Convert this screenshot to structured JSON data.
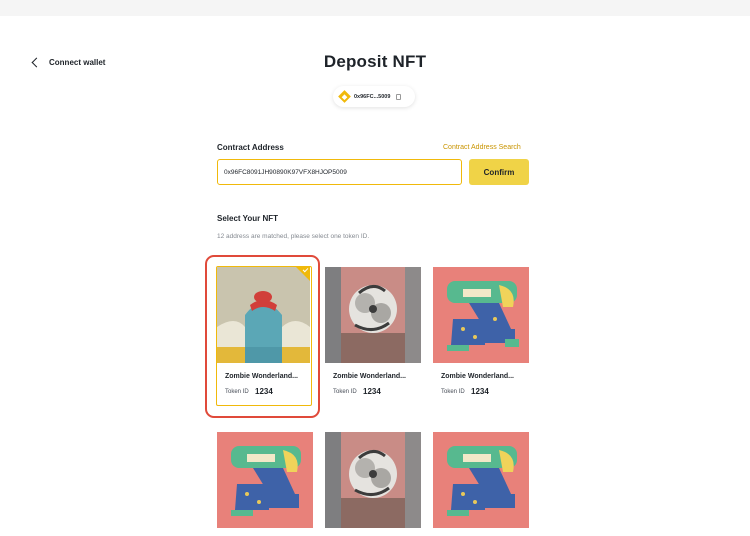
{
  "header": {
    "back_label": "Connect wallet",
    "title": "Deposit NFT",
    "wallet_address": "0x96FC...5009"
  },
  "contract": {
    "label": "Contract Address",
    "search_link": "Contract Address Search",
    "value": "0x96FC8091JH90890K97VFX8HJOP5009",
    "confirm_label": "Confirm"
  },
  "nft_section": {
    "label": "Select Your NFT",
    "hint": "12 address are matched, please select one token ID."
  },
  "nfts": [
    {
      "name": "Zombie Wonderland...",
      "token_id_label": "Token ID",
      "token_id": "1234",
      "art": "blob",
      "selected": true
    },
    {
      "name": "Zombie Wonderland...",
      "token_id_label": "Token ID",
      "token_id": "1234",
      "art": "face",
      "selected": false
    },
    {
      "name": "Zombie Wonderland...",
      "token_id_label": "Token ID",
      "token_id": "1234",
      "art": "crouch",
      "selected": false
    },
    {
      "name": "",
      "token_id_label": "",
      "token_id": "",
      "art": "crouch",
      "selected": false
    },
    {
      "name": "",
      "token_id_label": "",
      "token_id": "",
      "art": "face",
      "selected": false
    },
    {
      "name": "",
      "token_id_label": "",
      "token_id": "",
      "art": "crouch",
      "selected": false
    }
  ],
  "colors": {
    "accent": "#f0b90b",
    "selection_outline": "#e04a3a",
    "link": "#c99400"
  }
}
